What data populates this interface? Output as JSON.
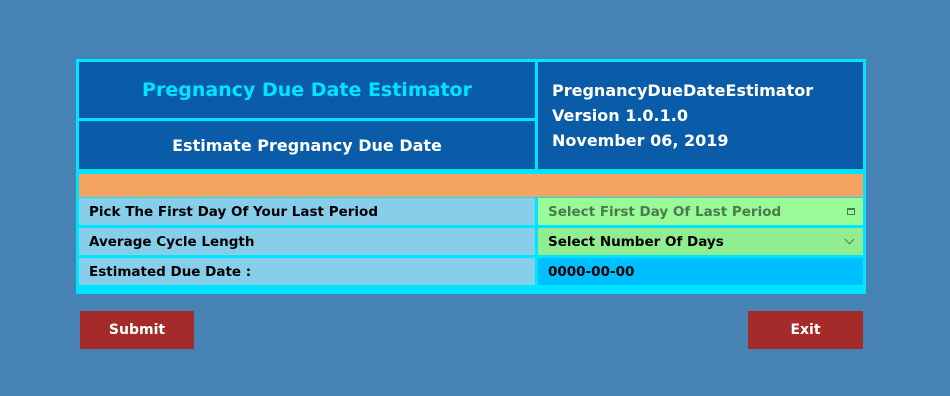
{
  "header": {
    "title": "Pregnancy Due Date Estimator",
    "subtitle": "Estimate Pregnancy Due Date"
  },
  "app_info": {
    "name": "PregnancyDueDateEstimator",
    "version": "Version 1.0.1.0",
    "date": "November 06, 2019"
  },
  "form": {
    "period_label": "Pick The First Day Of Your Last Period",
    "period_value": "Select First Day Of Last Period",
    "cycle_label": "Average Cycle Length",
    "cycle_value": "Select Number Of Days",
    "due_label": "Estimated Due Date :",
    "due_value": "0000-00-00"
  },
  "buttons": {
    "submit": "Submit",
    "exit": "Exit"
  },
  "icons": {
    "date_picker": "calendar-icon",
    "dropdown": "chevron-down-icon"
  },
  "colors": {
    "background": "#4682B4",
    "frame": "#00E5FF",
    "header_bg": "#0A5CA8",
    "title_text": "#00E5FF",
    "accent_bar": "#F4A460",
    "label_bg": "#87CEEB",
    "date_field_bg": "#98FB98",
    "select_field_bg": "#90EE90",
    "result_bg": "#00BFFF",
    "button_bg": "#A52A2A"
  }
}
